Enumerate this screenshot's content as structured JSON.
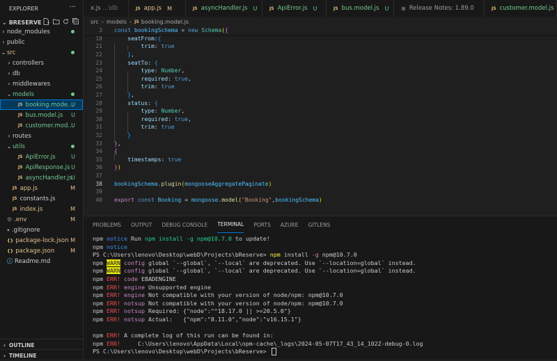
{
  "sidebar": {
    "title": "EXPLORER",
    "project": "BRESERVE",
    "items": [
      {
        "label": "node_modules",
        "type": "folder",
        "open": false,
        "depth": 1,
        "status_color": "#73c991",
        "dot": true
      },
      {
        "label": "public",
        "type": "folder",
        "open": false,
        "depth": 1
      },
      {
        "label": "src",
        "type": "folder",
        "open": true,
        "depth": 1,
        "dot": true,
        "label_color": "#e2c08d"
      },
      {
        "label": "controllers",
        "type": "folder",
        "open": false,
        "depth": 2
      },
      {
        "label": "db",
        "type": "folder",
        "open": false,
        "depth": 2
      },
      {
        "label": "middlewares",
        "type": "folder",
        "open": false,
        "depth": 2
      },
      {
        "label": "models",
        "type": "folder",
        "open": true,
        "depth": 2,
        "dot": true,
        "label_color": "#73c991"
      },
      {
        "label": "booking.mode...",
        "type": "js",
        "depth": 3,
        "status": "U",
        "selected": true,
        "label_color": "#73c991"
      },
      {
        "label": "bus.model.js",
        "type": "js",
        "depth": 3,
        "status": "U",
        "label_color": "#73c991"
      },
      {
        "label": "customer.mod...",
        "type": "js",
        "depth": 3,
        "status": "U",
        "label_color": "#73c991"
      },
      {
        "label": "routes",
        "type": "folder",
        "open": false,
        "depth": 2
      },
      {
        "label": "utils",
        "type": "folder",
        "open": true,
        "depth": 2,
        "dot": true,
        "label_color": "#73c991"
      },
      {
        "label": "ApiError.js",
        "type": "js",
        "depth": 3,
        "status": "U",
        "label_color": "#73c991"
      },
      {
        "label": "ApiResponse.js",
        "type": "js",
        "depth": 3,
        "status": "U",
        "label_color": "#73c991"
      },
      {
        "label": "asyncHandler.js",
        "type": "js",
        "depth": 3,
        "status": "U",
        "label_color": "#73c991"
      },
      {
        "label": "app.js",
        "type": "js",
        "depth": 2,
        "status": "M",
        "label_color": "#e2c08d"
      },
      {
        "label": "constants.js",
        "type": "js",
        "depth": 2
      },
      {
        "label": "index.js",
        "type": "js",
        "depth": 2,
        "status": "M",
        "label_color": "#e2c08d"
      },
      {
        "label": ".env",
        "type": "gear",
        "depth": 1,
        "status": "M",
        "label_color": "#e2c08d"
      },
      {
        "label": ".gitignore",
        "type": "git",
        "depth": 1
      },
      {
        "label": "package-lock.json",
        "type": "json",
        "depth": 1,
        "status": "M",
        "label_color": "#e2c08d"
      },
      {
        "label": "package.json",
        "type": "json",
        "depth": 1,
        "status": "M",
        "label_color": "#e2c08d"
      },
      {
        "label": "Readme.md",
        "type": "info",
        "depth": 1
      }
    ],
    "outline_label": "OUTLINE",
    "timeline_label": "TIMELINE"
  },
  "tabs": [
    {
      "icon": "",
      "label": "x.js",
      "desc": "...\\db",
      "mod": "",
      "color": "#9d9d9d"
    },
    {
      "icon": "JS",
      "label": "app.js",
      "desc": "",
      "mod": "M",
      "color": "#e2c08d"
    },
    {
      "icon": "JS",
      "label": "asyncHandler.js",
      "desc": "",
      "mod": "U",
      "color": "#73c991"
    },
    {
      "icon": "JS",
      "label": "ApiError.js",
      "desc": "",
      "mod": "U",
      "color": "#73c991"
    },
    {
      "icon": "JS",
      "label": "bus.model.js",
      "desc": "",
      "mod": "U",
      "color": "#73c991"
    },
    {
      "icon": "≡",
      "label": "Release Notes: 1.89.0",
      "desc": "",
      "mod": "",
      "color": "#9d9d9d"
    },
    {
      "icon": "JS",
      "label": "customer.model.js",
      "desc": "",
      "mod": "U",
      "color": "#73c991"
    }
  ],
  "breadcrumb": [
    "src",
    "models",
    "booking.model.js"
  ],
  "editor": {
    "current_line": "38",
    "lines": [
      {
        "n": "3",
        "html": "<span class='k'>const</span> <span class='v'>bookingSchema</span> = <span class='k'>new</span> <span class='t'>Schema</span><span class='b1'>(</span><span class='b2'>{</span>",
        "shadow": true
      },
      {
        "n": "18",
        "html": "    <span class='p'>seatFrom</span>:<span class='b3'>{</span>"
      },
      {
        "n": "21",
        "html": "        <span class='p'>trim</span>: <span class='k'>true</span>"
      },
      {
        "n": "22",
        "html": "    <span class='b3'>}</span>,"
      },
      {
        "n": "23",
        "html": "    <span class='p'>seatTo</span>: <span class='b3'>{</span>"
      },
      {
        "n": "24",
        "html": "        <span class='p'>type</span>: <span class='t'>Number</span>,"
      },
      {
        "n": "25",
        "html": "        <span class='p'>required</span>: <span class='k'>true</span>,"
      },
      {
        "n": "26",
        "html": "        <span class='p'>trim</span>: <span class='k'>true</span>"
      },
      {
        "n": "27",
        "html": "    <span class='b3'>}</span>,"
      },
      {
        "n": "28",
        "html": "    <span class='p'>status</span>: <span class='b3'>{</span>"
      },
      {
        "n": "29",
        "html": "        <span class='p'>type</span>: <span class='t'>Number</span>,"
      },
      {
        "n": "30",
        "html": "        <span class='p'>required</span>: <span class='k'>true</span>,"
      },
      {
        "n": "31",
        "html": "        <span class='p'>trim</span>: <span class='k'>true</span>"
      },
      {
        "n": "32",
        "html": "    <span class='b3'>}</span>"
      },
      {
        "n": "33",
        "html": "<span class='b2'>}</span>,"
      },
      {
        "n": "34",
        "html": "<span class='b2'>{</span>"
      },
      {
        "n": "35",
        "html": "    <span class='p'>timestamps</span>: <span class='k'>true</span>"
      },
      {
        "n": "36",
        "html": "<span class='b2'>}</span><span class='b1'>)</span>"
      },
      {
        "n": "37",
        "html": ""
      },
      {
        "n": "38",
        "html": "<span class='v'>bookingSchema</span>.<span class='f'>plugin</span><span class='b1'>(</span><span class='v'>mongooseAggregatePaginate</span><span class='b1'>)</span>"
      },
      {
        "n": "39",
        "html": ""
      },
      {
        "n": "40",
        "html": "<span class='k2'>export</span> <span class='k'>const</span> <span class='v'>Booking</span> = <span class='v'>mongoose</span>.<span class='f'>model</span><span class='b1'>(</span><span class='s'>\"Booking\"</span>,<span class='v'>bookingSchema</span><span class='b1'>)</span>"
      }
    ]
  },
  "panel": {
    "tabs": [
      "PROBLEMS",
      "OUTPUT",
      "DEBUG CONSOLE",
      "TERMINAL",
      "PORTS",
      "AZURE",
      "GITLENS"
    ],
    "active_tab": "TERMINAL",
    "terminal_lines": [
      {
        "html": "npm <span class='notice'>notice</span> Run <span class='cmdg'>npm install -g npm@10.7.0</span> to update!"
      },
      {
        "html": "npm <span class='notice'>notice</span>"
      },
      {
        "html": "PS C:\\Users\\lenovo\\Desktop\\webD\\Projects\\bReserve&gt; <span class='cmdy'>npm</span> install <span class='label'>-g</span> npm@10.7.0"
      },
      {
        "html": "npm <span class='warnbg'>WARN</span> <span class='label'>config</span> global `--global`, `--local` are deprecated. Use `--location=global` instead."
      },
      {
        "html": "npm <span class='warnbg'>WARN</span> <span class='label'>config</span> global `--global`, `--local` are deprecated. Use `--location=global` instead."
      },
      {
        "html": "npm <span class='err'>ERR!</span> <span class='label'>code</span> EBADENGINE"
      },
      {
        "html": "npm <span class='err'>ERR!</span> <span class='label'>engine</span> Unsupported engine"
      },
      {
        "html": "npm <span class='err'>ERR!</span> <span class='label'>engine</span> Not compatible with your version of node/npm: npm@10.7.0"
      },
      {
        "html": "npm <span class='err'>ERR!</span> <span class='label'>notsup</span> Not compatible with your version of node/npm: npm@10.7.0"
      },
      {
        "html": "npm <span class='err'>ERR!</span> <span class='label'>notsup</span> Required: {\"node\":\"^18.17.0 || &gt;=20.5.0\"}"
      },
      {
        "html": "npm <span class='err'>ERR!</span> <span class='label'>notsup</span> Actual:   {\"npm\":\"8.11.0\",\"node\":\"v16.15.1\"}"
      },
      {
        "html": ""
      },
      {
        "html": "npm <span class='err'>ERR!</span> A complete log of this run can be found in:"
      },
      {
        "html": "npm <span class='err'>ERR!</span>     C:\\Users\\lenovo\\AppData\\Local\\npm-cache\\_logs\\2024-05-07T17_43_14_102Z-debug-0.log"
      },
      {
        "html": "PS C:\\Users\\lenovo\\Desktop\\webD\\Projects\\bReserve&gt; <span class='cursor'></span>"
      }
    ]
  }
}
